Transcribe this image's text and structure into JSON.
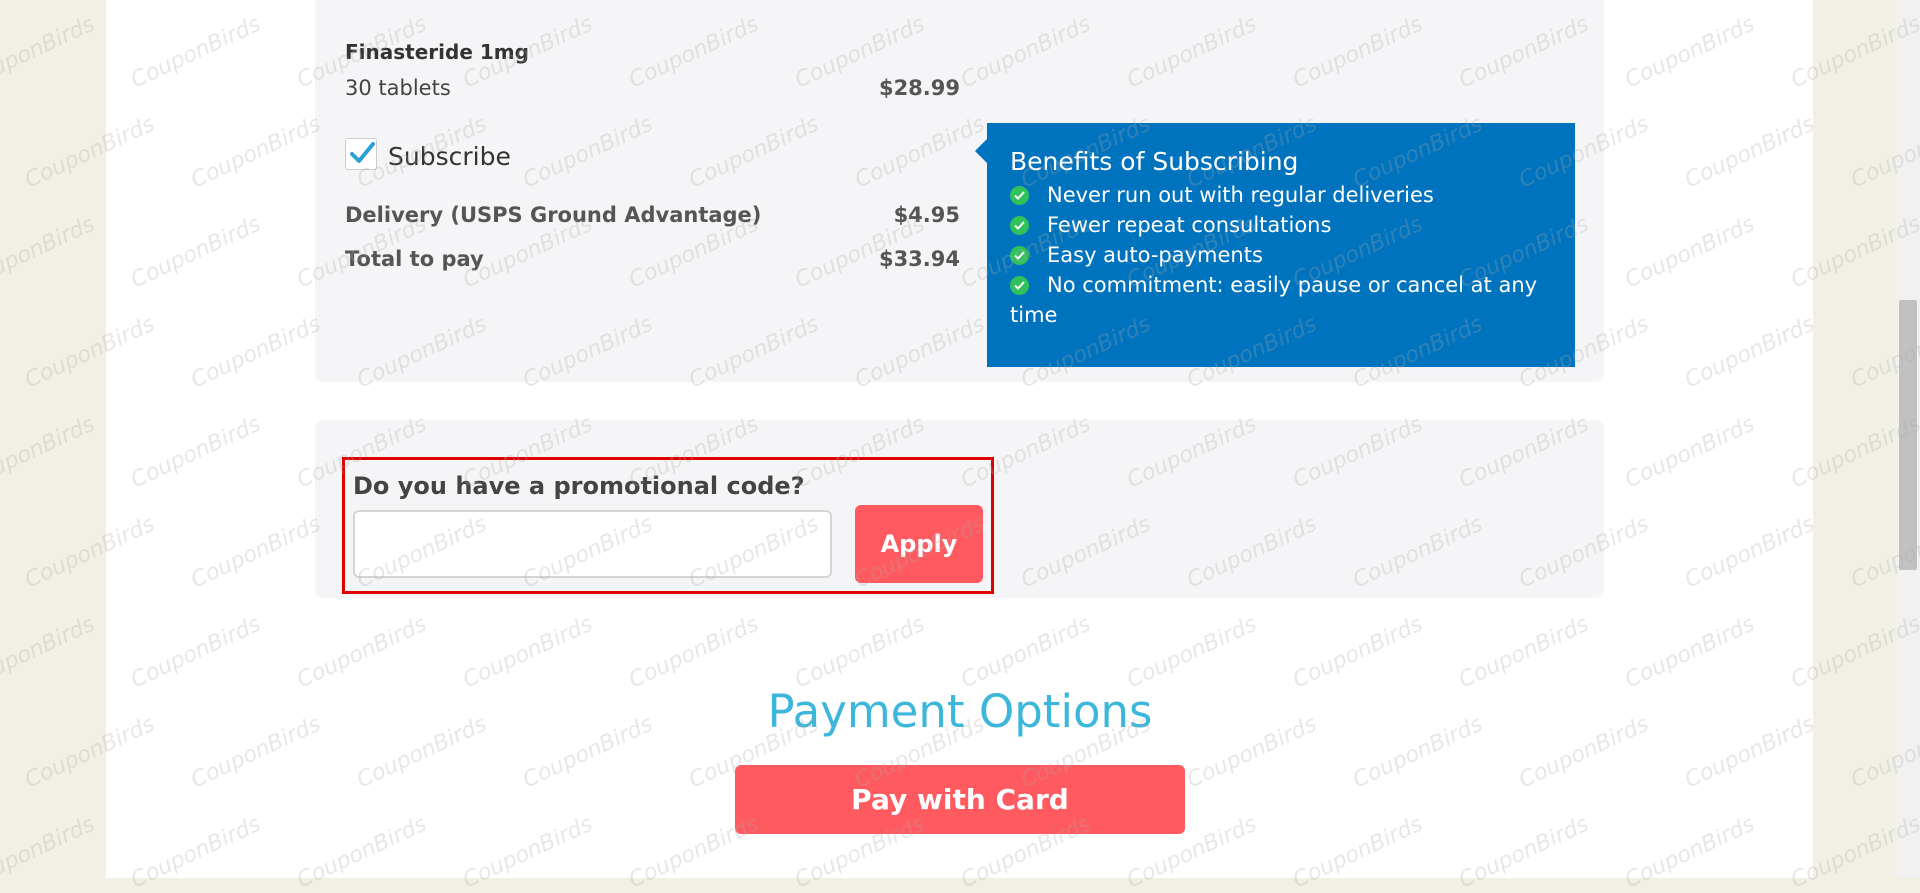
{
  "order_summary": {
    "product_name": "Finasteride 1mg",
    "quantity": "30 tablets",
    "price": "$28.99",
    "subscribe": {
      "label": "Subscribe",
      "checked": true
    },
    "delivery": {
      "label": "Delivery (USPS Ground Advantage)",
      "value": "$4.95"
    },
    "total": {
      "label": "Total to pay",
      "value": "$33.94"
    }
  },
  "benefits": {
    "title": "Benefits of Subscribing",
    "items": [
      "Never run out with regular deliveries",
      "Fewer repeat consultations",
      "Easy auto-payments",
      "No commitment: easily pause or cancel at any time"
    ]
  },
  "promo": {
    "question": "Do you have a promotional code?",
    "input_value": "",
    "apply_label": "Apply"
  },
  "payment": {
    "title": "Payment Options",
    "pay_card_label": "Pay with Card"
  },
  "watermark_text": "CouponBirds",
  "colors": {
    "accent": "#ff5a5f",
    "benefits_bg": "#0073be",
    "payment_title": "#3db6dc",
    "check_green": "#2fc25b",
    "highlight": "#e00000"
  }
}
